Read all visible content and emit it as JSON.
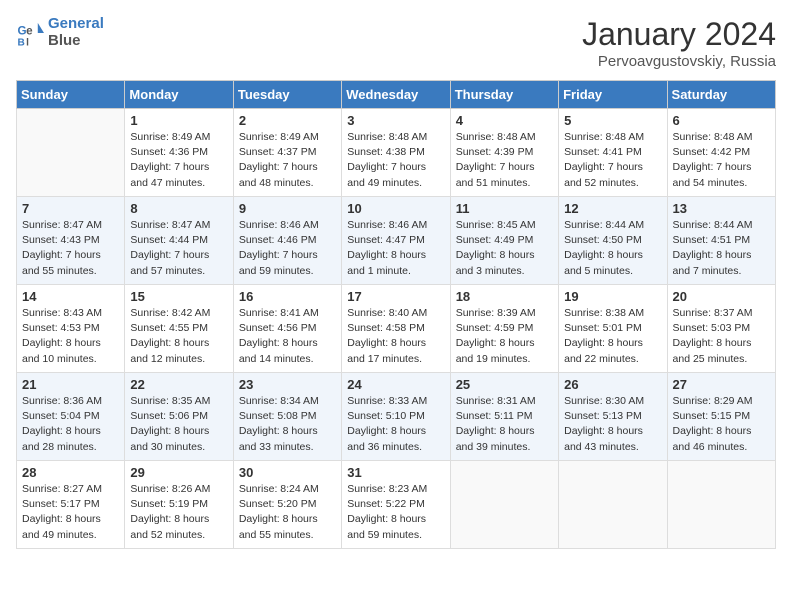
{
  "header": {
    "logo_line1": "General",
    "logo_line2": "Blue",
    "month": "January 2024",
    "location": "Pervoavgustovskiy, Russia"
  },
  "weekdays": [
    "Sunday",
    "Monday",
    "Tuesday",
    "Wednesday",
    "Thursday",
    "Friday",
    "Saturday"
  ],
  "weeks": [
    [
      {
        "day": "",
        "sunrise": "",
        "sunset": "",
        "daylight": ""
      },
      {
        "day": "1",
        "sunrise": "Sunrise: 8:49 AM",
        "sunset": "Sunset: 4:36 PM",
        "daylight": "Daylight: 7 hours and 47 minutes."
      },
      {
        "day": "2",
        "sunrise": "Sunrise: 8:49 AM",
        "sunset": "Sunset: 4:37 PM",
        "daylight": "Daylight: 7 hours and 48 minutes."
      },
      {
        "day": "3",
        "sunrise": "Sunrise: 8:48 AM",
        "sunset": "Sunset: 4:38 PM",
        "daylight": "Daylight: 7 hours and 49 minutes."
      },
      {
        "day": "4",
        "sunrise": "Sunrise: 8:48 AM",
        "sunset": "Sunset: 4:39 PM",
        "daylight": "Daylight: 7 hours and 51 minutes."
      },
      {
        "day": "5",
        "sunrise": "Sunrise: 8:48 AM",
        "sunset": "Sunset: 4:41 PM",
        "daylight": "Daylight: 7 hours and 52 minutes."
      },
      {
        "day": "6",
        "sunrise": "Sunrise: 8:48 AM",
        "sunset": "Sunset: 4:42 PM",
        "daylight": "Daylight: 7 hours and 54 minutes."
      }
    ],
    [
      {
        "day": "7",
        "sunrise": "Sunrise: 8:47 AM",
        "sunset": "Sunset: 4:43 PM",
        "daylight": "Daylight: 7 hours and 55 minutes."
      },
      {
        "day": "8",
        "sunrise": "Sunrise: 8:47 AM",
        "sunset": "Sunset: 4:44 PM",
        "daylight": "Daylight: 7 hours and 57 minutes."
      },
      {
        "day": "9",
        "sunrise": "Sunrise: 8:46 AM",
        "sunset": "Sunset: 4:46 PM",
        "daylight": "Daylight: 7 hours and 59 minutes."
      },
      {
        "day": "10",
        "sunrise": "Sunrise: 8:46 AM",
        "sunset": "Sunset: 4:47 PM",
        "daylight": "Daylight: 8 hours and 1 minute."
      },
      {
        "day": "11",
        "sunrise": "Sunrise: 8:45 AM",
        "sunset": "Sunset: 4:49 PM",
        "daylight": "Daylight: 8 hours and 3 minutes."
      },
      {
        "day": "12",
        "sunrise": "Sunrise: 8:44 AM",
        "sunset": "Sunset: 4:50 PM",
        "daylight": "Daylight: 8 hours and 5 minutes."
      },
      {
        "day": "13",
        "sunrise": "Sunrise: 8:44 AM",
        "sunset": "Sunset: 4:51 PM",
        "daylight": "Daylight: 8 hours and 7 minutes."
      }
    ],
    [
      {
        "day": "14",
        "sunrise": "Sunrise: 8:43 AM",
        "sunset": "Sunset: 4:53 PM",
        "daylight": "Daylight: 8 hours and 10 minutes."
      },
      {
        "day": "15",
        "sunrise": "Sunrise: 8:42 AM",
        "sunset": "Sunset: 4:55 PM",
        "daylight": "Daylight: 8 hours and 12 minutes."
      },
      {
        "day": "16",
        "sunrise": "Sunrise: 8:41 AM",
        "sunset": "Sunset: 4:56 PM",
        "daylight": "Daylight: 8 hours and 14 minutes."
      },
      {
        "day": "17",
        "sunrise": "Sunrise: 8:40 AM",
        "sunset": "Sunset: 4:58 PM",
        "daylight": "Daylight: 8 hours and 17 minutes."
      },
      {
        "day": "18",
        "sunrise": "Sunrise: 8:39 AM",
        "sunset": "Sunset: 4:59 PM",
        "daylight": "Daylight: 8 hours and 19 minutes."
      },
      {
        "day": "19",
        "sunrise": "Sunrise: 8:38 AM",
        "sunset": "Sunset: 5:01 PM",
        "daylight": "Daylight: 8 hours and 22 minutes."
      },
      {
        "day": "20",
        "sunrise": "Sunrise: 8:37 AM",
        "sunset": "Sunset: 5:03 PM",
        "daylight": "Daylight: 8 hours and 25 minutes."
      }
    ],
    [
      {
        "day": "21",
        "sunrise": "Sunrise: 8:36 AM",
        "sunset": "Sunset: 5:04 PM",
        "daylight": "Daylight: 8 hours and 28 minutes."
      },
      {
        "day": "22",
        "sunrise": "Sunrise: 8:35 AM",
        "sunset": "Sunset: 5:06 PM",
        "daylight": "Daylight: 8 hours and 30 minutes."
      },
      {
        "day": "23",
        "sunrise": "Sunrise: 8:34 AM",
        "sunset": "Sunset: 5:08 PM",
        "daylight": "Daylight: 8 hours and 33 minutes."
      },
      {
        "day": "24",
        "sunrise": "Sunrise: 8:33 AM",
        "sunset": "Sunset: 5:10 PM",
        "daylight": "Daylight: 8 hours and 36 minutes."
      },
      {
        "day": "25",
        "sunrise": "Sunrise: 8:31 AM",
        "sunset": "Sunset: 5:11 PM",
        "daylight": "Daylight: 8 hours and 39 minutes."
      },
      {
        "day": "26",
        "sunrise": "Sunrise: 8:30 AM",
        "sunset": "Sunset: 5:13 PM",
        "daylight": "Daylight: 8 hours and 43 minutes."
      },
      {
        "day": "27",
        "sunrise": "Sunrise: 8:29 AM",
        "sunset": "Sunset: 5:15 PM",
        "daylight": "Daylight: 8 hours and 46 minutes."
      }
    ],
    [
      {
        "day": "28",
        "sunrise": "Sunrise: 8:27 AM",
        "sunset": "Sunset: 5:17 PM",
        "daylight": "Daylight: 8 hours and 49 minutes."
      },
      {
        "day": "29",
        "sunrise": "Sunrise: 8:26 AM",
        "sunset": "Sunset: 5:19 PM",
        "daylight": "Daylight: 8 hours and 52 minutes."
      },
      {
        "day": "30",
        "sunrise": "Sunrise: 8:24 AM",
        "sunset": "Sunset: 5:20 PM",
        "daylight": "Daylight: 8 hours and 55 minutes."
      },
      {
        "day": "31",
        "sunrise": "Sunrise: 8:23 AM",
        "sunset": "Sunset: 5:22 PM",
        "daylight": "Daylight: 8 hours and 59 minutes."
      },
      {
        "day": "",
        "sunrise": "",
        "sunset": "",
        "daylight": ""
      },
      {
        "day": "",
        "sunrise": "",
        "sunset": "",
        "daylight": ""
      },
      {
        "day": "",
        "sunrise": "",
        "sunset": "",
        "daylight": ""
      }
    ]
  ]
}
